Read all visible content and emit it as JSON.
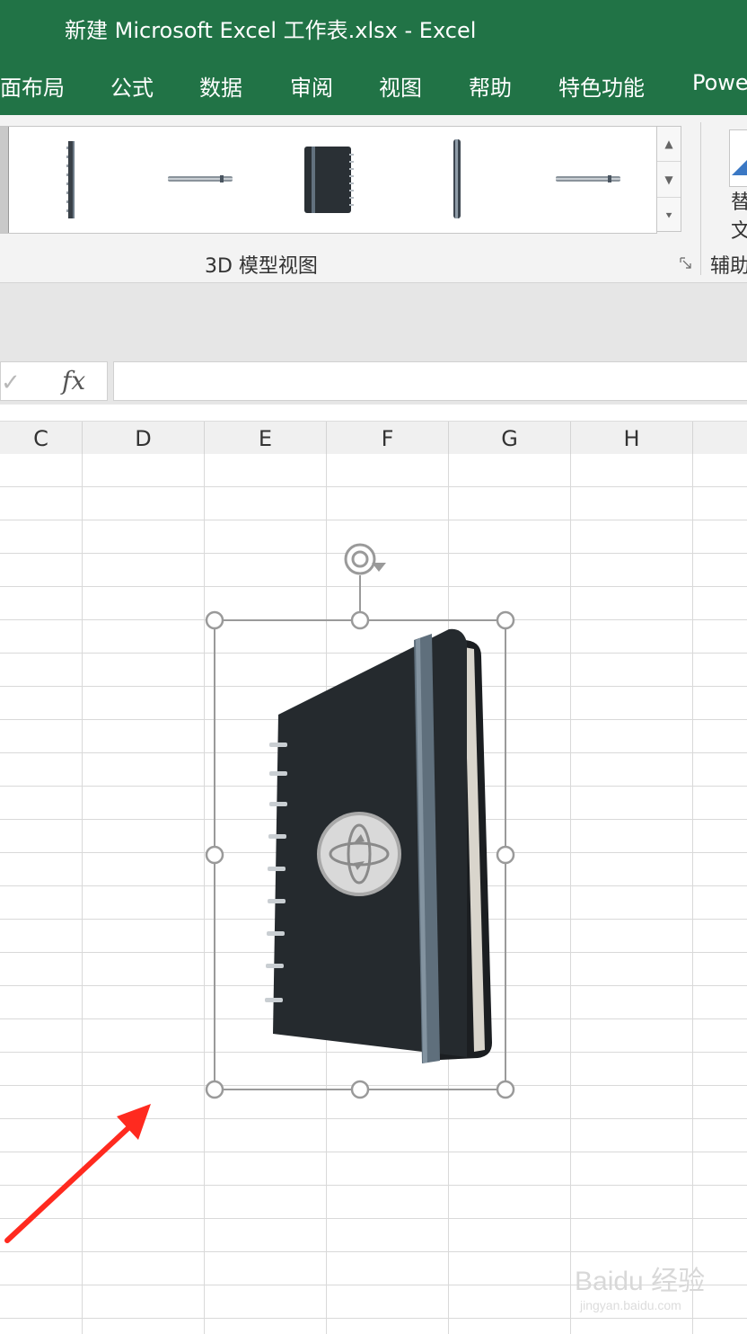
{
  "window": {
    "title": "新建 Microsoft Excel 工作表.xlsx  -  Excel"
  },
  "ribbon_tabs": [
    "面布局",
    "公式",
    "数据",
    "审阅",
    "视图",
    "帮助",
    "特色功能",
    "Powe"
  ],
  "ribbon": {
    "gallery_items": [
      "model-view-front",
      "model-view-spine-edge",
      "model-view-top",
      "model-view-angled",
      "model-view-side",
      "model-view-bottom"
    ],
    "group_label": "3D 模型视图",
    "right_group_label": "辅助",
    "right_button_label_line1": "替",
    "right_button_label_line2": "文"
  },
  "formula_bar": {
    "fx_label": "fx",
    "check_label": "✓",
    "value": ""
  },
  "columns": [
    "C",
    "D",
    "E",
    "F",
    "G",
    "H"
  ],
  "model": {
    "name": "3D notebook model",
    "icons": [
      "rotate-handle-icon",
      "3d-rotate-icon"
    ]
  },
  "colors": {
    "excel_green": "#217346",
    "notebook_cover": "#252a2e",
    "notebook_band": "#5f6f7c",
    "annotation_arrow": "#ff2a1f"
  },
  "watermark": {
    "text": "Baidu 经验",
    "sub": "jingyan.baidu.com"
  }
}
